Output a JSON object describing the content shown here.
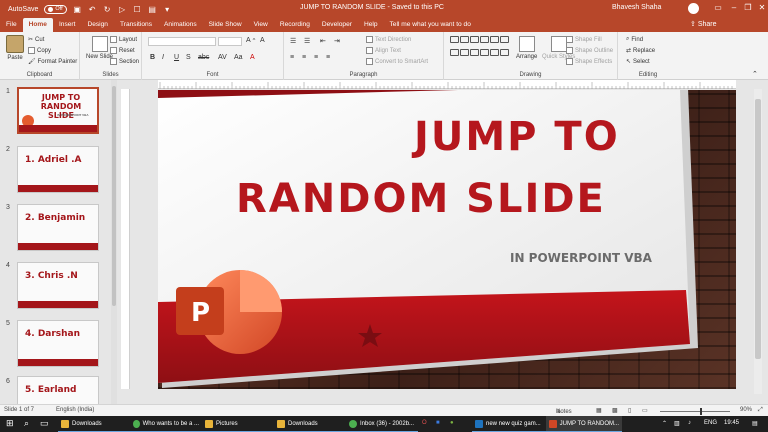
{
  "titlebar": {
    "autosave_label": "AutoSave",
    "autosave_state": "Off",
    "document_title": "JUMP TO RANDOM SLIDE - Saved to this PC",
    "user_name": "Bhavesh Shaha"
  },
  "tabs": [
    "File",
    "Home",
    "Insert",
    "Design",
    "Transitions",
    "Animations",
    "Slide Show",
    "View",
    "Recording",
    "Developer",
    "Help",
    "Tell me what you want to do"
  ],
  "share_label": "Share",
  "ribbon": {
    "clipboard": {
      "paste": "Paste",
      "cut": "Cut",
      "copy": "Copy",
      "format_painter": "Format Painter",
      "label": "Clipboard"
    },
    "slides": {
      "new_slide": "New Slide",
      "layout": "Layout",
      "reset": "Reset",
      "section": "Section",
      "label": "Slides"
    },
    "font": {
      "label": "Font"
    },
    "paragraph": {
      "text_direction": "Text Direction",
      "align_text": "Align Text",
      "convert_smartart": "Convert to SmartArt",
      "label": "Paragraph"
    },
    "drawing": {
      "arrange": "Arrange",
      "quick_styles": "Quick Styles",
      "shape_fill": "Shape Fill",
      "shape_outline": "Shape Outline",
      "shape_effects": "Shape Effects",
      "label": "Drawing"
    },
    "editing": {
      "find": "Find",
      "replace": "Replace",
      "select": "Select",
      "label": "Editing"
    }
  },
  "thumbnails": [
    {
      "num": "1",
      "title": "JUMP TO RANDOM SLIDE",
      "subtitle": "IN POWERPOINT VBA"
    },
    {
      "num": "2",
      "label": "1. Adriel .A"
    },
    {
      "num": "3",
      "label": "2. Benjamin"
    },
    {
      "num": "4",
      "label": "3. Chris .N"
    },
    {
      "num": "5",
      "label": "4. Darshan"
    },
    {
      "num": "6",
      "label": "5. Earland"
    }
  ],
  "slide": {
    "title_line1": "JUMP TO",
    "title_line2": "RANDOM SLIDE",
    "subtitle": "IN POWERPOINT VBA",
    "logo_letter": "P"
  },
  "statusbar": {
    "slide_info": "Slide 1 of 7",
    "language": "English (India)",
    "notes": "Notes",
    "zoom": "90%"
  },
  "taskbar": {
    "items": [
      "Downloads",
      "Who wants to be a ...",
      "Pictures",
      "Downloads",
      "Inbox (36) - 2002b...",
      "new new quiz gam...",
      "JUMP TO RANDOM..."
    ],
    "language": "ENG",
    "time": "19:45"
  },
  "colors": {
    "accent": "#b7472a",
    "slide_red": "#b5171d"
  }
}
